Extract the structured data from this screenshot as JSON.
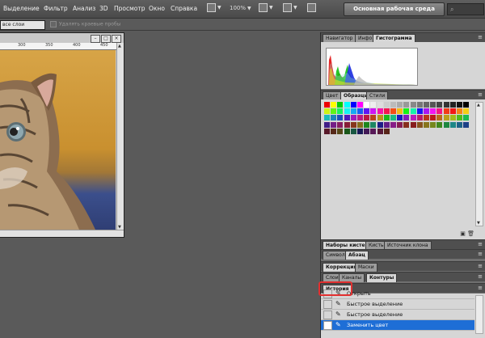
{
  "menu": [
    "Выделение",
    "Фильтр",
    "Анализ",
    "3D",
    "Просмотр",
    "Окно",
    "Справка"
  ],
  "toolbar": {
    "zoom": "100%",
    "workspace": "Основная рабочая среда"
  },
  "options": {
    "sample_layers": "все слои",
    "auto_erase": "Удалять краевые пробы"
  },
  "ruler": [
    "300",
    "350",
    "400",
    "450"
  ],
  "panels": {
    "top_tabs": [
      "Навигатор",
      "Инфо",
      "Гистограмма"
    ],
    "swatch_tabs": [
      "Цвет",
      "Образцы",
      "Стили"
    ],
    "brush_tabs": [
      "Наборы кистей",
      "Кисть",
      "Источник клона"
    ],
    "char_tabs": [
      "Символ",
      "Абзац"
    ],
    "corr_tabs": [
      "Коррекция",
      "Маски"
    ],
    "layers_tabs": [
      "Слои",
      "Каналы",
      "Контуры"
    ],
    "history_tab": "История"
  },
  "history": {
    "items": [
      {
        "label": "Открыть",
        "selected": false
      },
      {
        "label": "Быстрое выделение",
        "selected": false
      },
      {
        "label": "Быстрое выделение",
        "selected": false
      },
      {
        "label": "Заменить цвет",
        "selected": true
      }
    ]
  },
  "colors": {
    "accent_selected": "#1e6ed6",
    "callout": "#e23030"
  },
  "icons": [
    "search-icon",
    "screen-mode-icon",
    "arrange-icon",
    "panel-menu-icon",
    "new-snapshot-icon",
    "trash-icon"
  ]
}
